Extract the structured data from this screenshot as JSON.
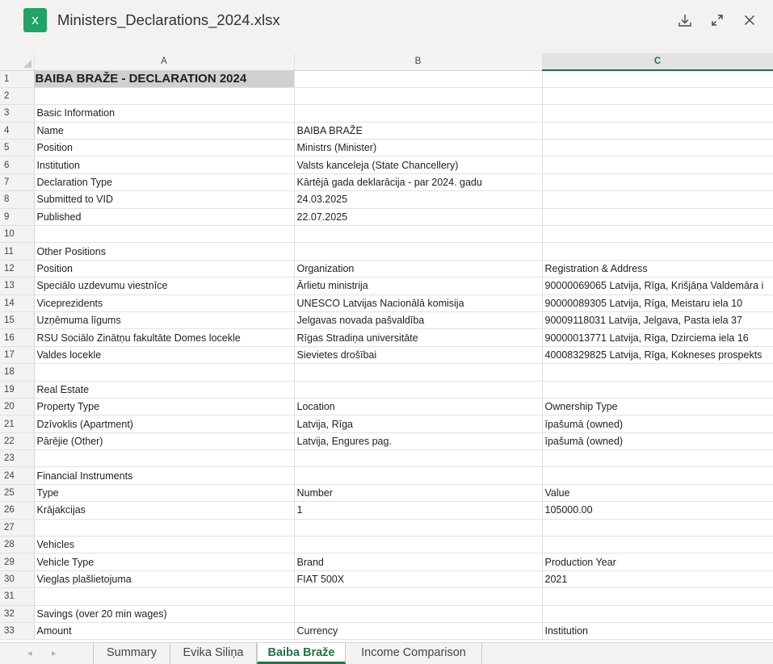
{
  "window": {
    "file_icon_letter": "x",
    "file_name": "Ministers_Declarations_2024.xlsx",
    "download_icon": "download-icon",
    "expand_icon": "expand-icon",
    "close_icon": "close-icon"
  },
  "columns": [
    "A",
    "B",
    "C"
  ],
  "selected_column": "C",
  "rows": [
    {
      "n": "1",
      "a": "BAIBA BRAŽE - DECLARATION 2024",
      "b": "",
      "c": ""
    },
    {
      "n": "2",
      "a": "",
      "b": "",
      "c": ""
    },
    {
      "n": "3",
      "a": "Basic Information",
      "b": "",
      "c": ""
    },
    {
      "n": "4",
      "a": "Name",
      "b": "BAIBA BRAŽE",
      "c": ""
    },
    {
      "n": "5",
      "a": "Position",
      "b": "Ministrs (Minister)",
      "c": ""
    },
    {
      "n": "6",
      "a": "Institution",
      "b": "Valsts kanceleja (State Chancellery)",
      "c": ""
    },
    {
      "n": "7",
      "a": "Declaration Type",
      "b": "Kārtējā gada deklarācija - par 2024. gadu",
      "c": ""
    },
    {
      "n": "8",
      "a": "Submitted to VID",
      "b": "24.03.2025",
      "c": ""
    },
    {
      "n": "9",
      "a": "Published",
      "b": "22.07.2025",
      "c": ""
    },
    {
      "n": "10",
      "a": "",
      "b": "",
      "c": ""
    },
    {
      "n": "11",
      "a": "Other Positions",
      "b": "",
      "c": ""
    },
    {
      "n": "12",
      "a": "Position",
      "b": "Organization",
      "c": "Registration & Address"
    },
    {
      "n": "13",
      "a": "Speciālo uzdevumu viestnīce",
      "b": "Ārlietu ministrija",
      "c": "90000069065 Latvija, Rīga, Krišjāņa Valdemāra i"
    },
    {
      "n": "14",
      "a": "Viceprezidents",
      "b": "UNESCO Latvijas Nacionālā komisija",
      "c": "90000089305 Latvija, Rīga, Meistaru iela 10"
    },
    {
      "n": "15",
      "a": "Uzņēmuma līgums",
      "b": "Jelgavas novada pašvaldība",
      "c": "90009118031 Latvija, Jelgava, Pasta iela 37"
    },
    {
      "n": "16",
      "a": "RSU Sociālo Zinātņu fakultāte Domes locekle",
      "b": "Rīgas Stradiņa universitāte",
      "c": "90000013771 Latvija, Rīga, Dzirciema iela 16"
    },
    {
      "n": "17",
      "a": "Valdes locekle",
      "b": "Sievietes drošībai",
      "c": "40008329825 Latvija, Rīga, Kokneses prospekts"
    },
    {
      "n": "18",
      "a": "",
      "b": "",
      "c": ""
    },
    {
      "n": "19",
      "a": "Real Estate",
      "b": "",
      "c": ""
    },
    {
      "n": "20",
      "a": "Property Type",
      "b": "Location",
      "c": "Ownership Type"
    },
    {
      "n": "21",
      "a": "Dzīvoklis (Apartment)",
      "b": "Latvija, Rīga",
      "c": "īpašumā (owned)"
    },
    {
      "n": "22",
      "a": "Pārējie (Other)",
      "b": "Latvija, Engures pag.",
      "c": "īpašumā (owned)"
    },
    {
      "n": "23",
      "a": "",
      "b": "",
      "c": ""
    },
    {
      "n": "24",
      "a": "Financial Instruments",
      "b": "",
      "c": ""
    },
    {
      "n": "25",
      "a": "Type",
      "b": "Number",
      "c": "Value"
    },
    {
      "n": "26",
      "a": "Krājakcijas",
      "b": "1",
      "c": "105000.00"
    },
    {
      "n": "27",
      "a": "",
      "b": "",
      "c": ""
    },
    {
      "n": "28",
      "a": "Vehicles",
      "b": "",
      "c": ""
    },
    {
      "n": "29",
      "a": "Vehicle Type",
      "b": "Brand",
      "c": "Production Year"
    },
    {
      "n": "30",
      "a": "Vieglas plašlietojuma",
      "b": "FIAT 500X",
      "c": "2021"
    },
    {
      "n": "31",
      "a": "",
      "b": "",
      "c": ""
    },
    {
      "n": "32",
      "a": "Savings (over 20 min wages)",
      "b": "",
      "c": ""
    },
    {
      "n": "33",
      "a": "Amount",
      "b": "Currency",
      "c": "Institution"
    }
  ],
  "sheet_tabs": [
    {
      "label": "Summary",
      "active": false
    },
    {
      "label": "Evika Siliņa",
      "active": false
    },
    {
      "label": "Baiba Braže",
      "active": true
    },
    {
      "label": "Income Comparison",
      "active": false
    }
  ],
  "sheet_nav": {
    "prev": "◂",
    "next": "▸"
  },
  "colors": {
    "accent": "#217346",
    "excel_icon": "#21a366",
    "title_cell_bg": "#d0d0d0"
  }
}
